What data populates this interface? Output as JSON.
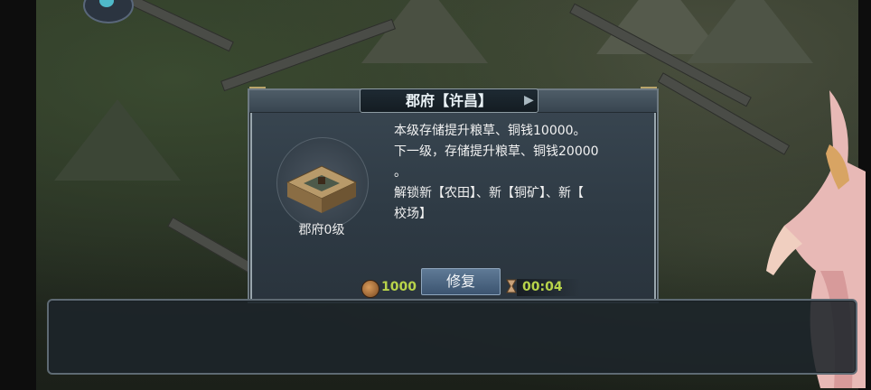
{
  "dialog": {
    "title": "郡府【许昌】",
    "building_label": "郡府0级",
    "description": [
      "本级存储提升粮草、铜钱10000。",
      "下一级，存储提升粮草、铜钱20000",
      "。",
      "解锁新【农田】、新【铜矿】、新【",
      "校场】"
    ],
    "cost_value": "1000",
    "repair_button_label": "修复",
    "timer_value": "00:04"
  },
  "icons": {
    "coin": "copper-coin-icon",
    "timer": "hourglass-icon",
    "avatar": "avatar-icon"
  },
  "colors": {
    "value_text": "#b8d44a",
    "dialog_bg": "#2e3a44",
    "button_bg": "#4f6884"
  }
}
